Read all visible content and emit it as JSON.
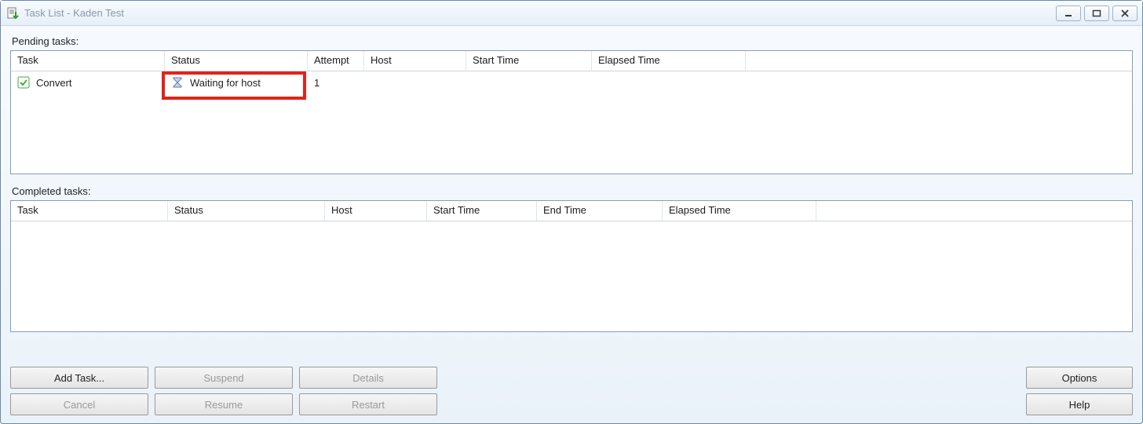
{
  "window": {
    "title": "Task List - Kaden Test"
  },
  "sections": {
    "pending_label": "Pending tasks:",
    "completed_label": "Completed tasks:"
  },
  "pending": {
    "columns": {
      "task": "Task",
      "status": "Status",
      "attempt": "Attempt",
      "host": "Host",
      "start_time": "Start Time",
      "elapsed_time": "Elapsed Time"
    },
    "rows": [
      {
        "task": "Convert",
        "status": "Waiting for host",
        "attempt": "1",
        "host": "",
        "start_time": "",
        "elapsed_time": ""
      }
    ]
  },
  "completed": {
    "columns": {
      "task": "Task",
      "status": "Status",
      "host": "Host",
      "start_time": "Start Time",
      "end_time": "End Time",
      "elapsed_time": "Elapsed Time"
    }
  },
  "buttons": {
    "add_task": "Add Task...",
    "suspend": "Suspend",
    "details": "Details",
    "cancel": "Cancel",
    "resume": "Resume",
    "restart": "Restart",
    "options": "Options",
    "help": "Help"
  }
}
